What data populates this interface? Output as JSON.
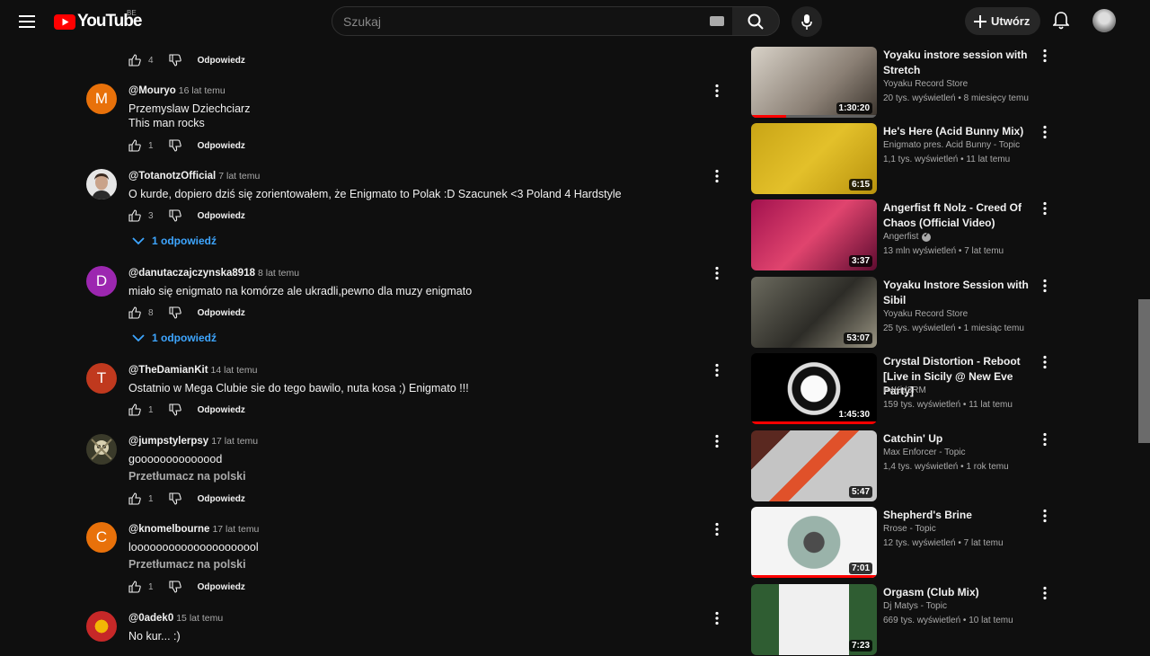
{
  "header": {
    "logo_text": "YouTube",
    "country_code": "BE",
    "search_placeholder": "Szukaj",
    "create_label": "Utwórz"
  },
  "comments": [
    {
      "author": "",
      "time": "",
      "text": "",
      "likes": "4",
      "reply_label": "Odpowiedz",
      "avatar_letter": "",
      "avatar_color": "#c2185b"
    },
    {
      "author": "@Mouryo",
      "time": "16 lat temu",
      "text": "Przemyslaw Dziechciarz",
      "text2": "This man rocks",
      "likes": "1",
      "reply_label": "Odpowiedz",
      "avatar_letter": "M",
      "avatar_color": "#e8710a"
    },
    {
      "author": "@TotanotzOfficial",
      "time": "7 lat temu",
      "text": "O kurde, dopiero dziś się zorientowałem, że Enigmato to Polak :D Szacunek <3 Poland 4 Hardstyle",
      "likes": "3",
      "reply_label": "Odpowiedz",
      "avatar_letter": "",
      "avatar_color": "#d9d9d9",
      "replies": "1 odpowiedź"
    },
    {
      "author": "@danutaczajczynska8918",
      "time": "8 lat temu",
      "text": "miało się enigmato na komórze ale ukradli,pewno dla muzy enigmato",
      "likes": "8",
      "reply_label": "Odpowiedz",
      "avatar_letter": "D",
      "avatar_color": "#9c27b0",
      "replies": "1 odpowiedź"
    },
    {
      "author": "@TheDamianKit",
      "time": "14 lat temu",
      "text": "Ostatnio w Mega Clubie sie do tego bawilo, nuta kosa ;) Enigmato !!!",
      "likes": "1",
      "reply_label": "Odpowiedz",
      "avatar_letter": "T",
      "avatar_color": "#c0391e"
    },
    {
      "author": "@jumpstylerpsy",
      "time": "17 lat temu",
      "text": "goooooooooooood",
      "translate": "Przetłumacz na polski",
      "likes": "1",
      "reply_label": "Odpowiedz",
      "avatar_letter": "",
      "avatar_color": "#3a3a2a"
    },
    {
      "author": "@knomelbourne",
      "time": "17 lat temu",
      "text": "looooooooooooooooooool",
      "translate": "Przetłumacz na polski",
      "likes": "1",
      "reply_label": "Odpowiedz",
      "avatar_letter": "C",
      "avatar_color": "#e8710a"
    },
    {
      "author": "@0adek0",
      "time": "15 lat temu",
      "text": "No kur... :)",
      "likes": "",
      "reply_label": "Odpowiedz",
      "avatar_letter": "",
      "avatar_color": "#c62828"
    }
  ],
  "videos": [
    {
      "title": "Yoyaku instore session with Stretch",
      "channel": "Yoyaku Record Store",
      "meta": "20 tys. wyświetleń • 8 miesięcy temu",
      "duration": "1:30:20",
      "thumb": "linear-gradient(135deg,#d8d2c8,#8a7f74 60%,#3b342d)",
      "progress": 0.28,
      "verified": false
    },
    {
      "title": "He's Here (Acid Bunny Mix)",
      "channel": "Enigmato pres. Acid Bunny - Topic",
      "meta": "1,1 tys. wyświetleń • 11 lat temu",
      "duration": "6:15",
      "thumb": "linear-gradient(135deg,#c9a516,#e3c02a 50%,#b8920d)",
      "progress": 0,
      "verified": false
    },
    {
      "title": "Angerfist ft Nolz - Creed Of Chaos (Official Video)",
      "channel": "Angerfist",
      "meta": "13 mln wyświetleń • 7 lat temu",
      "duration": "3:37",
      "thumb": "linear-gradient(135deg,#a3124f,#e0446e 50%,#5e0b30)",
      "progress": 0,
      "verified": true
    },
    {
      "title": "Yoyaku Instore Session with Sibil",
      "channel": "Yoyaku Record Store",
      "meta": "25 tys. wyświetleń • 1 miesiąc temu",
      "duration": "53:07",
      "thumb": "linear-gradient(135deg,#6b6a5e,#2d2c27 55%,#9a9583)",
      "progress": 0,
      "verified": false
    },
    {
      "title": "Crystal Distortion - Reboot [Live in Sicily @ New Eve Party]",
      "channel": "P4Kid3RM",
      "meta": "159 tys. wyświetleń • 11 lat temu",
      "duration": "1:45:30",
      "thumb": "radial-gradient(circle,#fafafa 0 18%,#111 19% 30%,#ddd 31% 36%,#000 37%)",
      "progress": 1.0,
      "verified": false
    },
    {
      "title": "Catchin' Up",
      "channel": "Max Enforcer - Topic",
      "meta": "1,4 tys. wyświetleń • 1 rok temu",
      "duration": "5:47",
      "thumb": "linear-gradient(135deg,#5a2820 0 20%,#c4c4c4 20% 45%,#e0512a 45% 55%,#c8c8c8 55%)",
      "progress": 0,
      "verified": false
    },
    {
      "title": "Shepherd's Brine",
      "channel": "Rrose - Topic",
      "meta": "12 tys. wyświetleń • 7 lat temu",
      "duration": "7:01",
      "thumb": "radial-gradient(circle,#4c4c4c 0 14%,#9ab3aa 15% 36%,#f4f4f4 37%)",
      "progress": 1.0,
      "verified": false
    },
    {
      "title": "Orgasm (Club Mix)",
      "channel": "Dj Matys - Topic",
      "meta": "669 tys. wyświetleń • 10 lat temu",
      "duration": "7:23",
      "thumb": "linear-gradient(90deg,#2f5d32 0 22%,#f0f0f0 22% 78%,#2f5d32 78%)",
      "progress": 0,
      "verified": false
    }
  ]
}
